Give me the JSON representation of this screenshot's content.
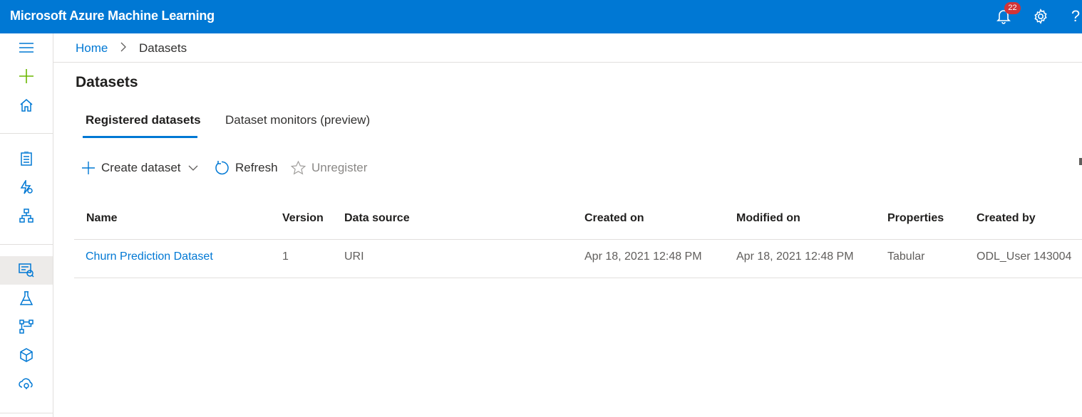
{
  "app": {
    "title": "Microsoft Azure Machine Learning",
    "notification_count": "22",
    "accent_color": "#0078d4",
    "badge_color": "#d13438",
    "icons": [
      "bell-icon",
      "gear-icon",
      "help-icon"
    ]
  },
  "rail": {
    "icons": [
      "hamburger-icon",
      "plus-icon",
      "home-icon",
      "notebook-icon",
      "automl-icon",
      "designer-icon",
      "datasets-icon",
      "experiments-icon",
      "pipelines-icon",
      "models-icon",
      "endpoints-icon"
    ],
    "active": "datasets-icon"
  },
  "breadcrumb": {
    "home": "Home",
    "current": "Datasets"
  },
  "page": {
    "title": "Datasets"
  },
  "tabs": [
    {
      "label": "Registered datasets",
      "selected": true
    },
    {
      "label": "Dataset monitors (preview)",
      "selected": false
    }
  ],
  "toolbar": {
    "create": "Create dataset",
    "refresh": "Refresh",
    "unregister": "Unregister"
  },
  "table": {
    "columns": [
      "Name",
      "Version",
      "Data source",
      "Created on",
      "Modified on",
      "Properties",
      "Created by"
    ],
    "rows": [
      {
        "name": "Churn Prediction Dataset",
        "version": "1",
        "data_source": "URI",
        "created_on": "Apr 18, 2021 12:48 PM",
        "modified_on": "Apr 18, 2021 12:48 PM",
        "properties": "Tabular",
        "created_by": "ODL_User 143004"
      }
    ]
  }
}
